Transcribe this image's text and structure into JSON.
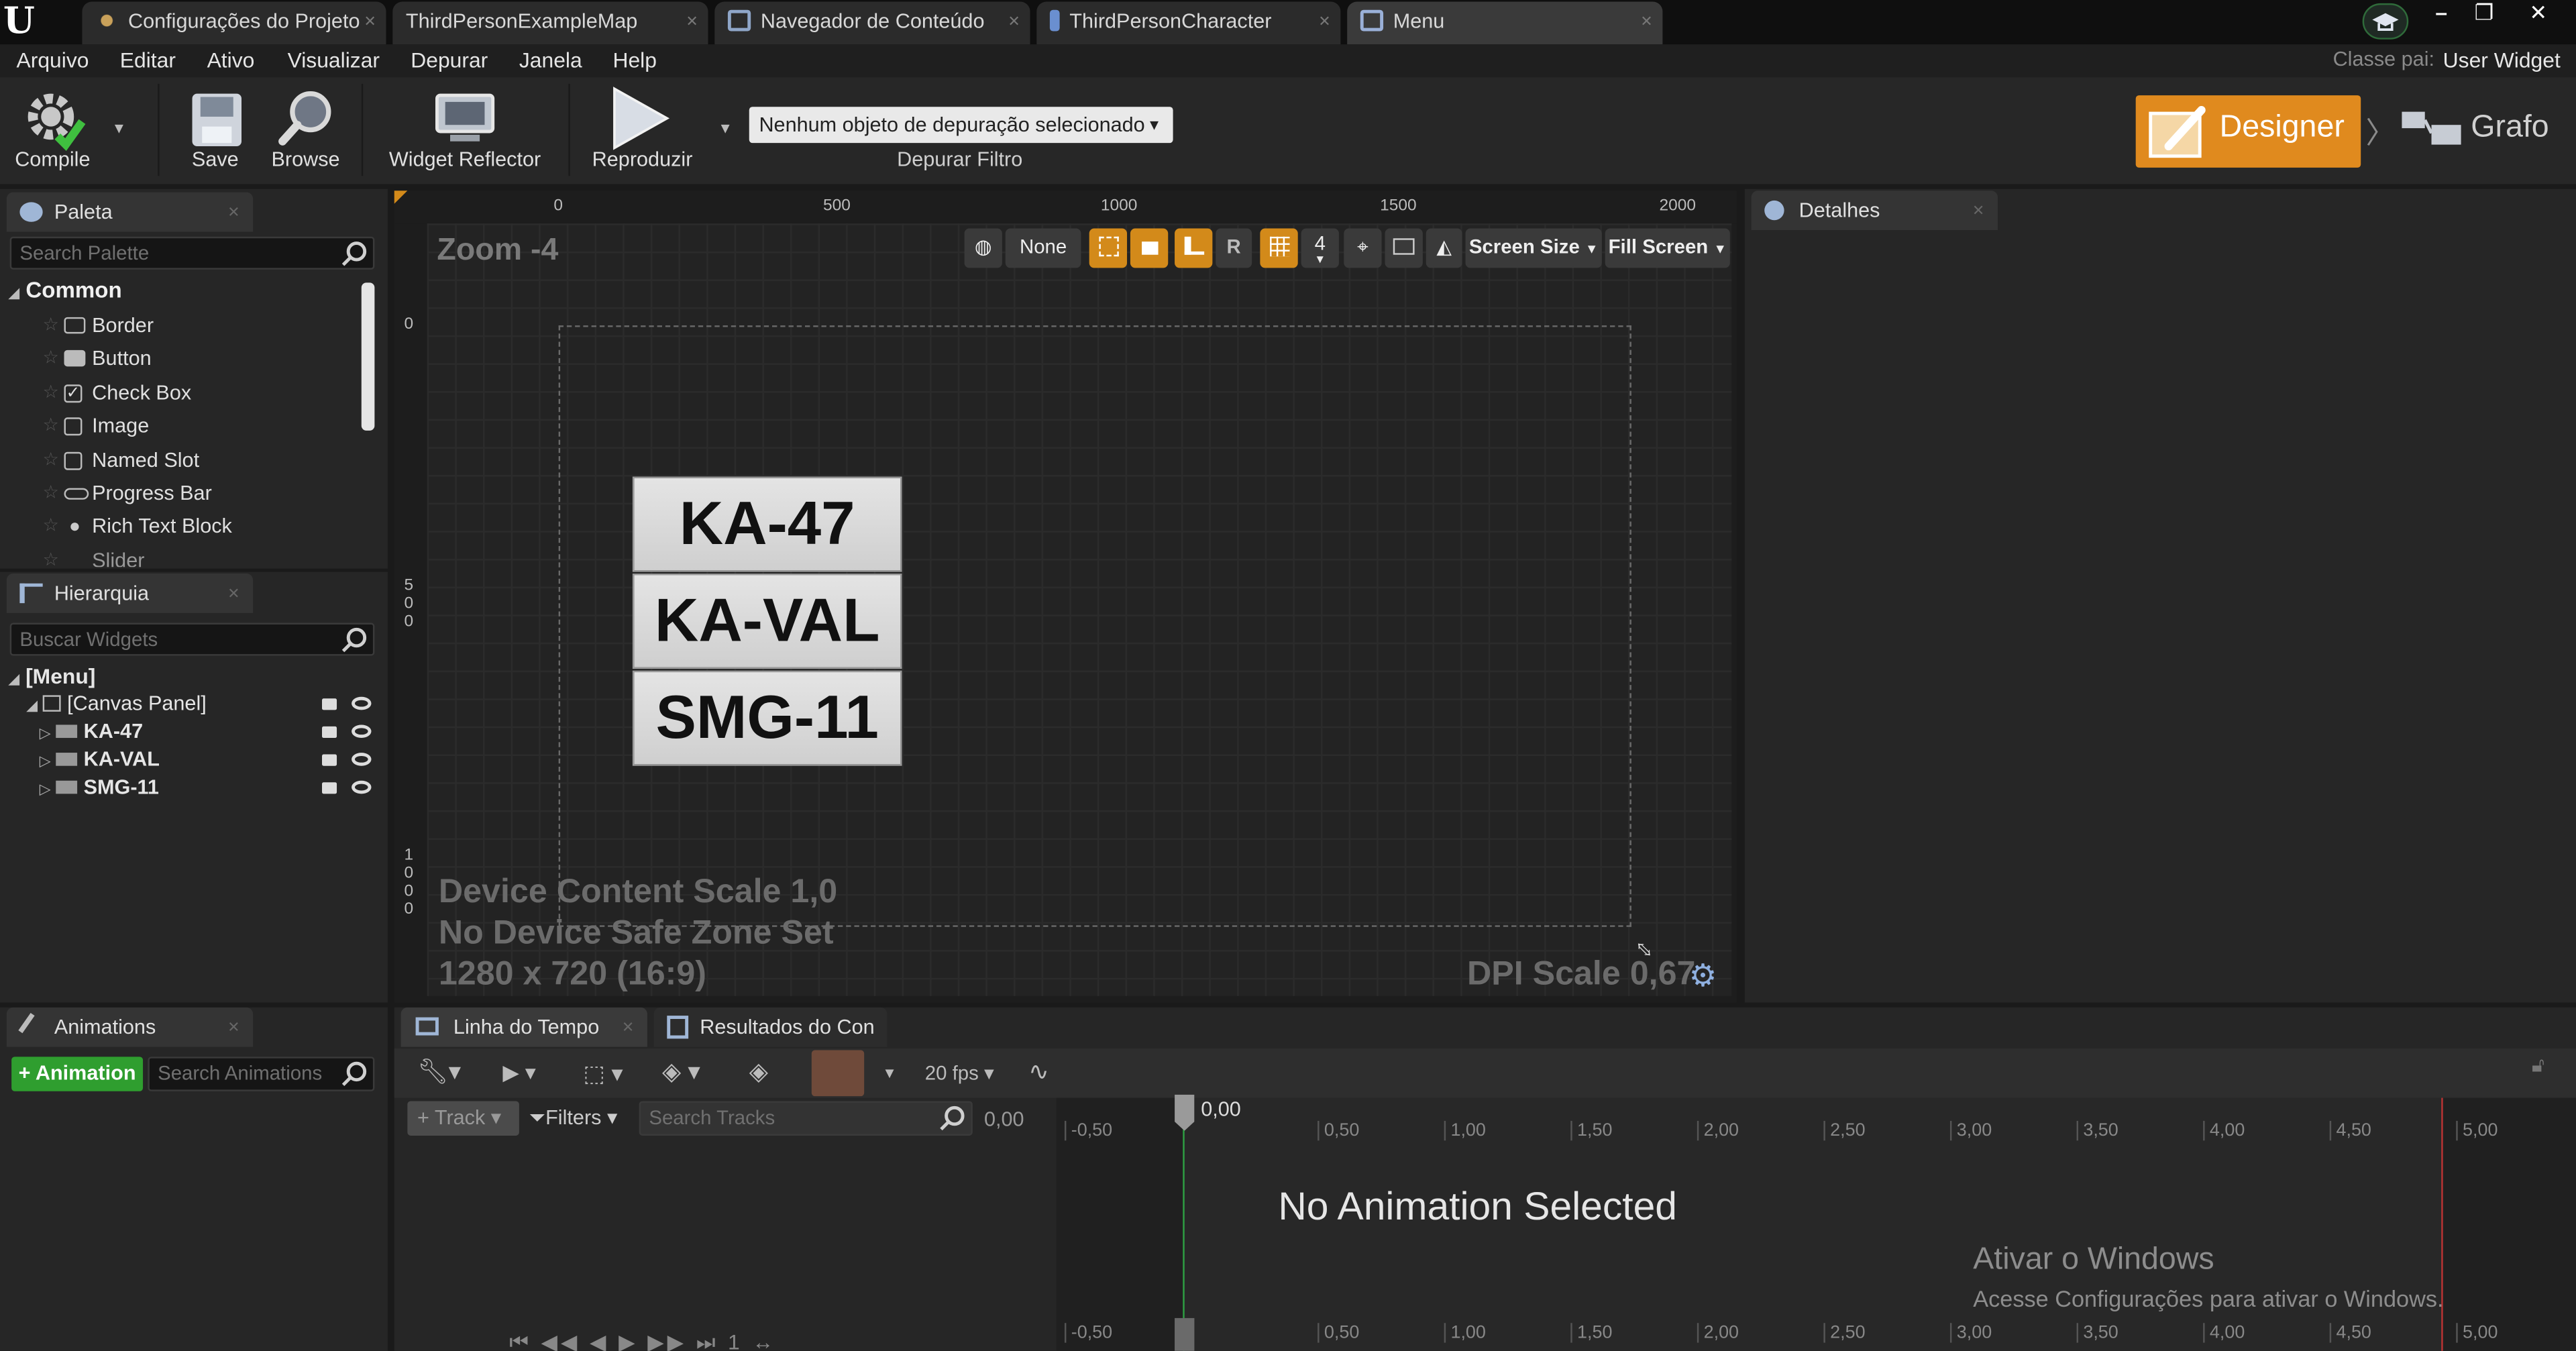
{
  "title_tabs": [
    {
      "label": "Configurações do Projeto",
      "icon": "gear-icon"
    },
    {
      "label": "ThirdPersonExampleMap",
      "icon": "map-icon"
    },
    {
      "label": "Navegador de Conteúdo",
      "icon": "content-browser-icon"
    },
    {
      "label": "ThirdPersonCharacter",
      "icon": "character-icon"
    },
    {
      "label": "Menu",
      "icon": "widget-blueprint-icon"
    }
  ],
  "menu": [
    "Arquivo",
    "Editar",
    "Ativo",
    "Visualizar",
    "Depurar",
    "Janela",
    "Help"
  ],
  "parent_class": {
    "label": "Classe pai:",
    "value": "User Widget"
  },
  "toolbar": {
    "compile": "Compile",
    "save": "Save",
    "browse": "Browse",
    "widget_reflector": "Widget Reflector",
    "play": "Reproduzir",
    "debug_select": "Nenhum objeto de depuração selecionado",
    "debug_filter": "Depurar Filtro",
    "designer": "Designer",
    "graph": "Grafo"
  },
  "palette": {
    "tab": "Paleta",
    "search_placeholder": "Search Palette",
    "category": "Common",
    "items": [
      "Border",
      "Button",
      "Check Box",
      "Image",
      "Named Slot",
      "Progress Bar",
      "Rich Text Block",
      "Slider"
    ]
  },
  "hierarchy": {
    "tab": "Hierarquia",
    "search_placeholder": "Buscar Widgets",
    "root": "[Menu]",
    "canvas": "[Canvas Panel]",
    "children": [
      "KA-47",
      "KA-VAL",
      "SMG-11"
    ]
  },
  "designer": {
    "zoom": "Zoom -4",
    "ruler_top": [
      "0",
      "500",
      "1000",
      "1500",
      "2000"
    ],
    "ruler_left": [
      "0",
      "5\n0\n0",
      "1\n0\n0\n0"
    ],
    "none_button": "None",
    "r_button": "R",
    "grid_size": "4",
    "screen_size": "Screen Size",
    "fill_screen": "Fill Screen",
    "widgets": [
      "KA-47",
      "KA-VAL",
      "SMG-11"
    ],
    "device_scale": "Device Content Scale 1,0",
    "safe_zone": "No Device Safe Zone Set",
    "resolution": "1280 x 720 (16:9)",
    "dpi": "DPI Scale 0,67"
  },
  "details": {
    "tab": "Detalhes"
  },
  "animations": {
    "tab": "Animations",
    "add_button": "+ Animation",
    "search_placeholder": "Search Animations"
  },
  "timeline": {
    "tab1": "Linha do Tempo",
    "tab2": "Resultados do Con",
    "fps": "20 fps",
    "track": "Track",
    "filters": "Filters",
    "search_placeholder": "Search Tracks",
    "time_value": "0,00",
    "playhead": "0,00",
    "ticks": [
      "-0,50",
      "0,00",
      "0,50",
      "1,00",
      "1,50",
      "2,00",
      "2,50",
      "3,00",
      "3,50",
      "4,00",
      "4,50",
      "5,00"
    ],
    "empty_message": "No Animation Selected"
  },
  "watermark": {
    "title": "Ativar o Windows",
    "subtitle": "Acesse Configurações para ativar o Windows."
  },
  "colors": {
    "accent_orange": "#d38a1a",
    "designer_orange": "#e08a1e",
    "add_green": "#2f9e2f"
  }
}
